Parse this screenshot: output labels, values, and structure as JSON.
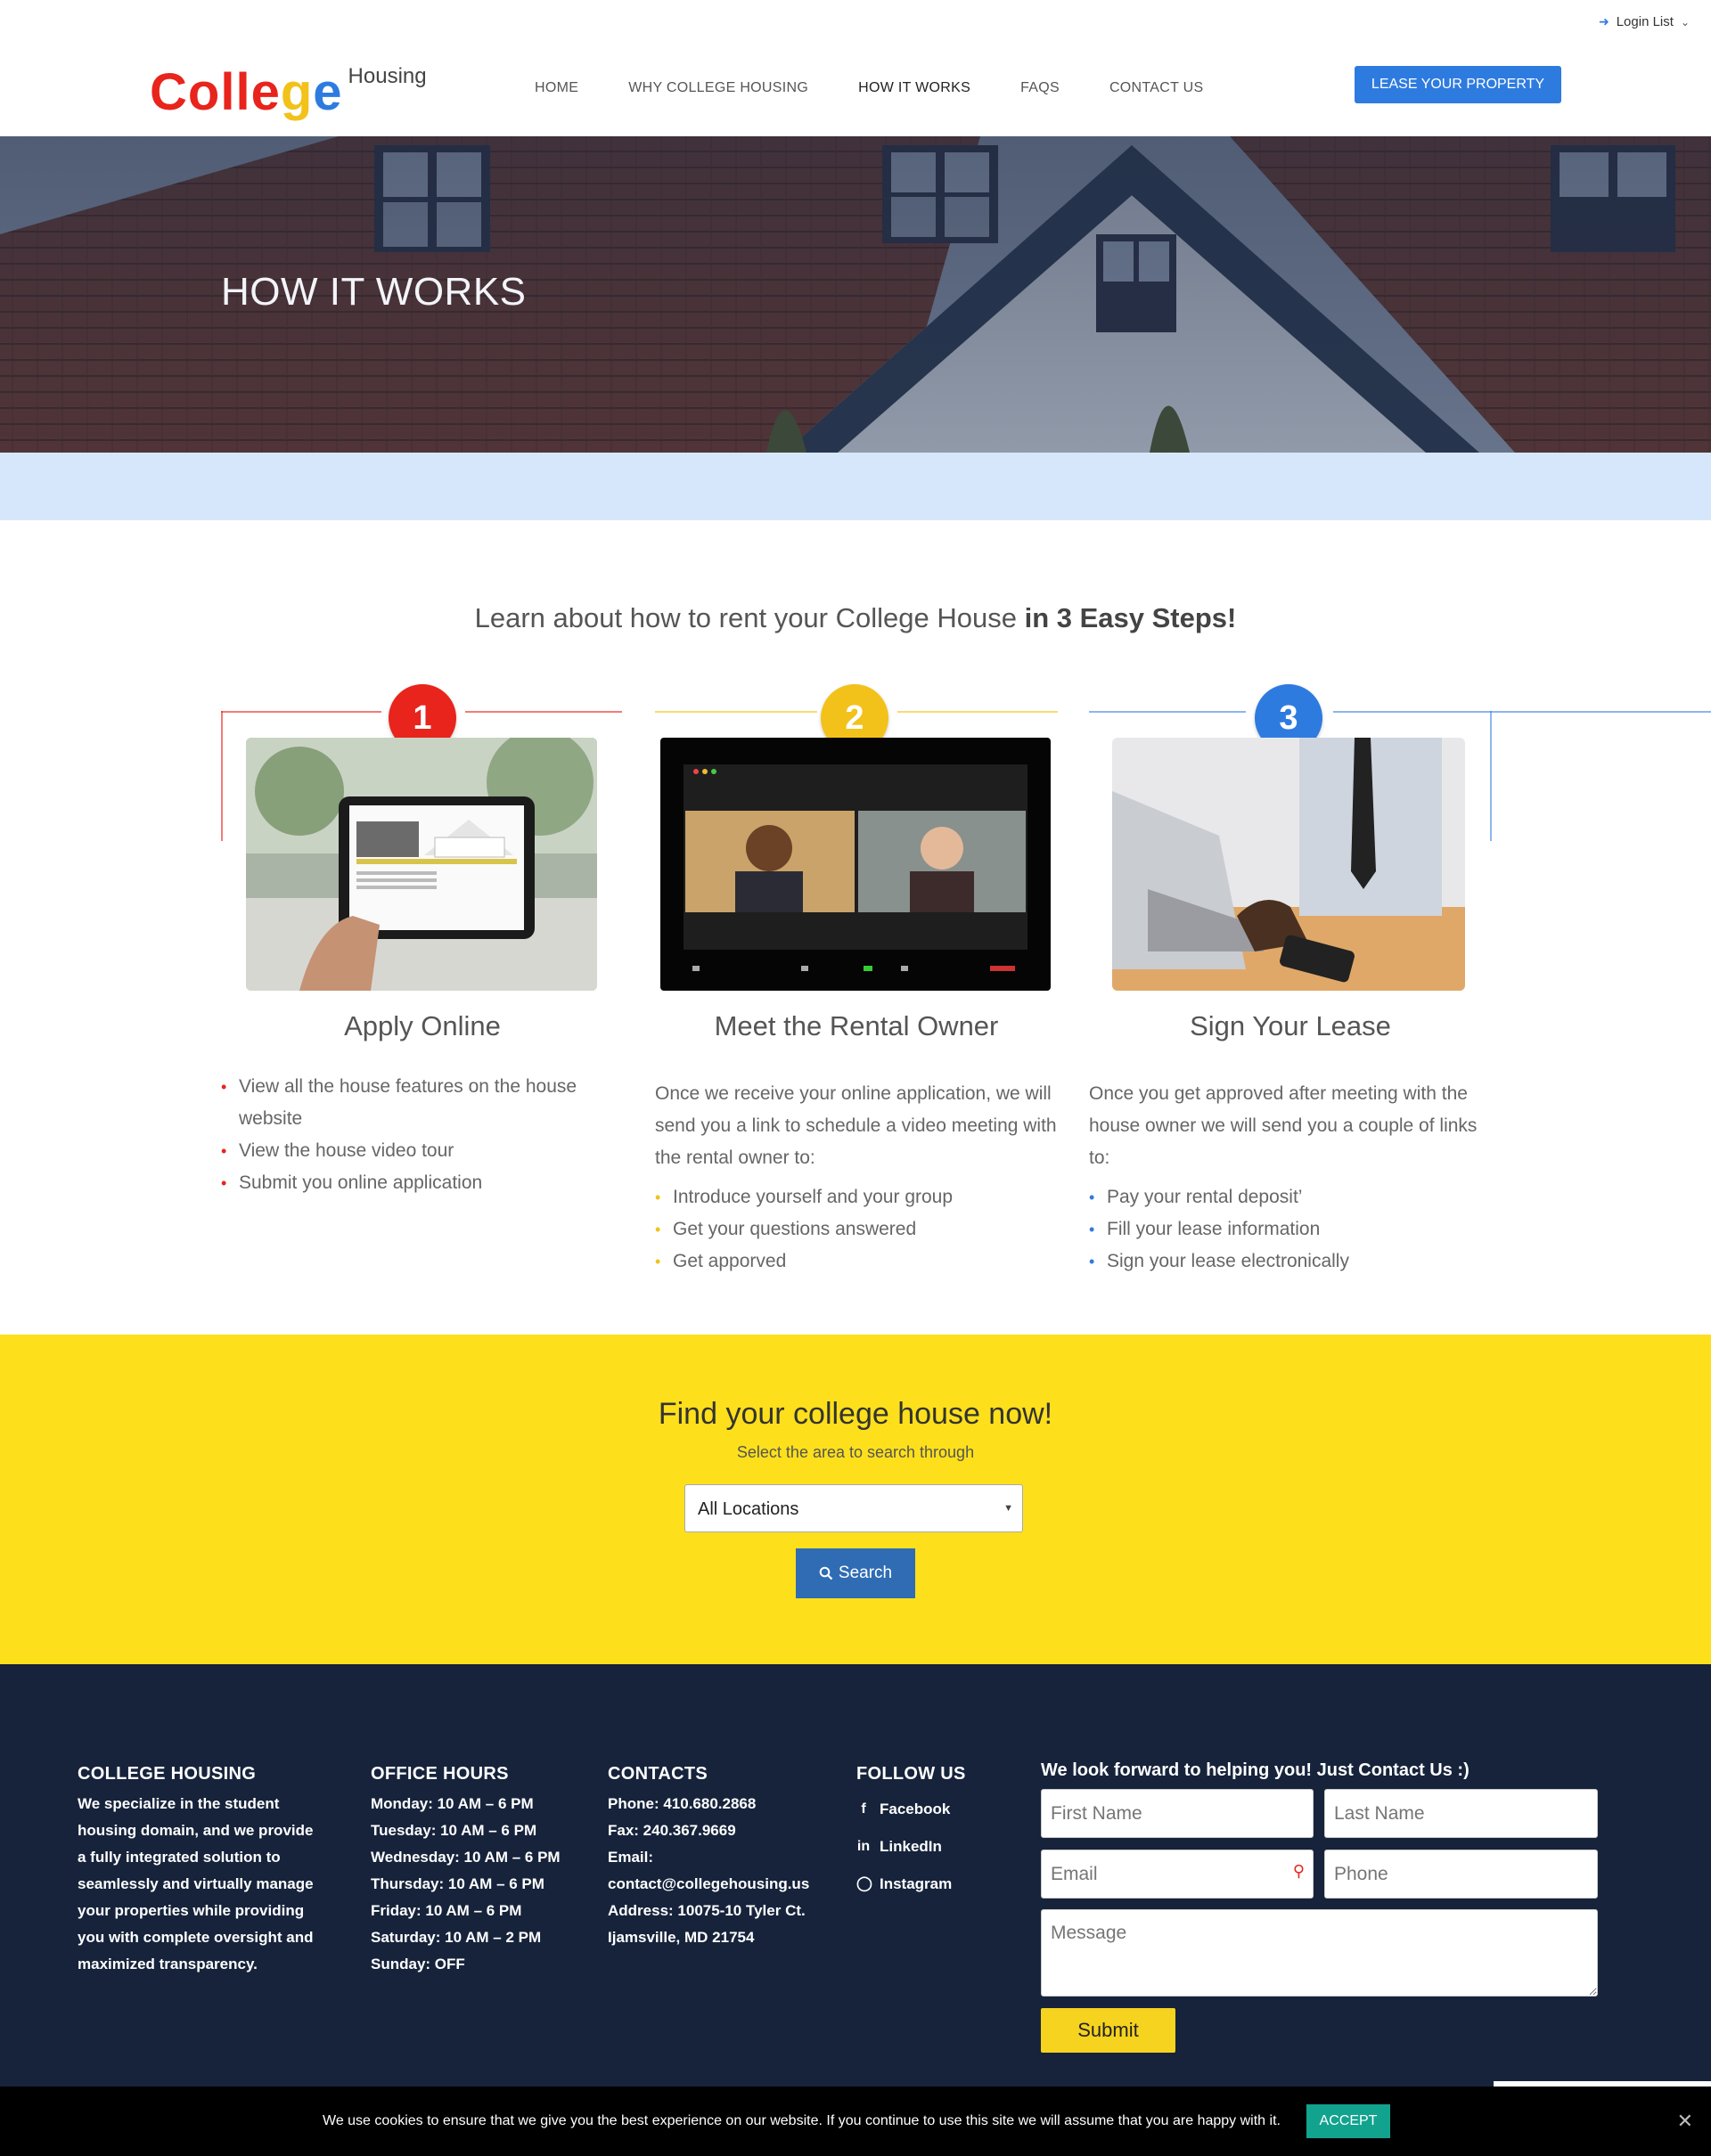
{
  "topbar": {
    "login_label": "Login List",
    "login_icon": "sign-in-icon",
    "chevron_icon": "chevron-down-icon"
  },
  "logo": {
    "letters": [
      {
        "ch": "C",
        "color": "#e8241c"
      },
      {
        "ch": "o",
        "color": "#e8241c"
      },
      {
        "ch": "l",
        "color": "#e8241c"
      },
      {
        "ch": "l",
        "color": "#e8241c"
      },
      {
        "ch": "e",
        "color": "#e8241c"
      },
      {
        "ch": "g",
        "color": "#f2c21a"
      },
      {
        "ch": "e",
        "color": "#2e7be0"
      }
    ],
    "word": "College",
    "sub": "Housing"
  },
  "nav": {
    "items": [
      {
        "label": "HOME"
      },
      {
        "label": "WHY COLLEGE HOUSING"
      },
      {
        "label": "HOW IT WORKS"
      },
      {
        "label": "FAQS"
      },
      {
        "label": "CONTACT US"
      }
    ],
    "active": "HOW IT WORKS",
    "lease_button": "LEASE YOUR PROPERTY"
  },
  "hero": {
    "title": "HOW IT WORKS"
  },
  "steps": {
    "heading_prefix": "Learn about how to rent your College House ",
    "heading_bold": "in 3 Easy Steps!",
    "items": [
      {
        "number": "1",
        "color": "#e8241c",
        "title": "Apply Online",
        "description": "",
        "bullets": [
          "View all the house features on the house website",
          "View the house video tour",
          "Submit you online application"
        ]
      },
      {
        "number": "2",
        "color": "#f2c21a",
        "title": "Meet the Rental Owner",
        "description": "Once we receive your online application, we will send you a link to schedule a video meeting with the rental owner to:",
        "bullets": [
          "Introduce yourself and your group",
          "Get your questions answered",
          "Get apporved"
        ]
      },
      {
        "number": "3",
        "color": "#2e7be0",
        "title": "Sign Your Lease",
        "description": "Once you get approved after meeting with the house owner we will send you a couple of links to:",
        "bullets": [
          "Pay your rental deposit’",
          "Fill your lease information",
          "Sign your lease electronically"
        ]
      }
    ]
  },
  "find": {
    "title": "Find your college house now!",
    "subtitle": "Select the area to search through",
    "selected_location": "All Locations",
    "search_label": "Search",
    "bg_color": "#fde01b"
  },
  "footer": {
    "about": {
      "heading": "COLLEGE HOUSING",
      "text": "We specialize in the student housing domain, and we provide a fully integrated solution to seamlessly and virtually manage your properties while providing you with complete oversight and maximized transparency."
    },
    "hours": {
      "heading": "OFFICE HOURS",
      "lines": [
        "Monday: 10 AM – 6 PM",
        "Tuesday: 10 AM – 6 PM",
        "Wednesday: 10 AM – 6 PM",
        "Thursday: 10 AM – 6 PM",
        "Friday: 10 AM – 6 PM",
        "Saturday: 10 AM – 2 PM",
        "Sunday: OFF"
      ]
    },
    "contacts": {
      "heading": "CONTACTS",
      "lines": [
        "Phone: 410.680.2868",
        "Fax: 240.367.9669",
        "Email:",
        "contact@collegehousing.us",
        "Address: 10075-10 Tyler Ct.",
        "Ijamsville, MD 21754"
      ]
    },
    "follow": {
      "heading": "FOLLOW US",
      "links": [
        {
          "label": "Facebook",
          "icon": "facebook-icon"
        },
        {
          "label": "LinkedIn",
          "icon": "linkedin-icon"
        },
        {
          "label": "Instagram",
          "icon": "instagram-icon"
        }
      ]
    },
    "form": {
      "heading": "We look forward to helping you! Just Contact Us :)",
      "first_name_placeholder": "First Name",
      "last_name_placeholder": "Last Name",
      "email_placeholder": "Email",
      "phone_placeholder": "Phone",
      "message_placeholder": "Message",
      "submit_label": "Submit"
    },
    "bg_color": "#16233b"
  },
  "cookie": {
    "text": "We use cookies to ensure that we give you the best experience on our website. If you continue to use this site we will assume that you are happy with it.",
    "accept_label": "ACCEPT",
    "close_icon": "close-icon"
  }
}
